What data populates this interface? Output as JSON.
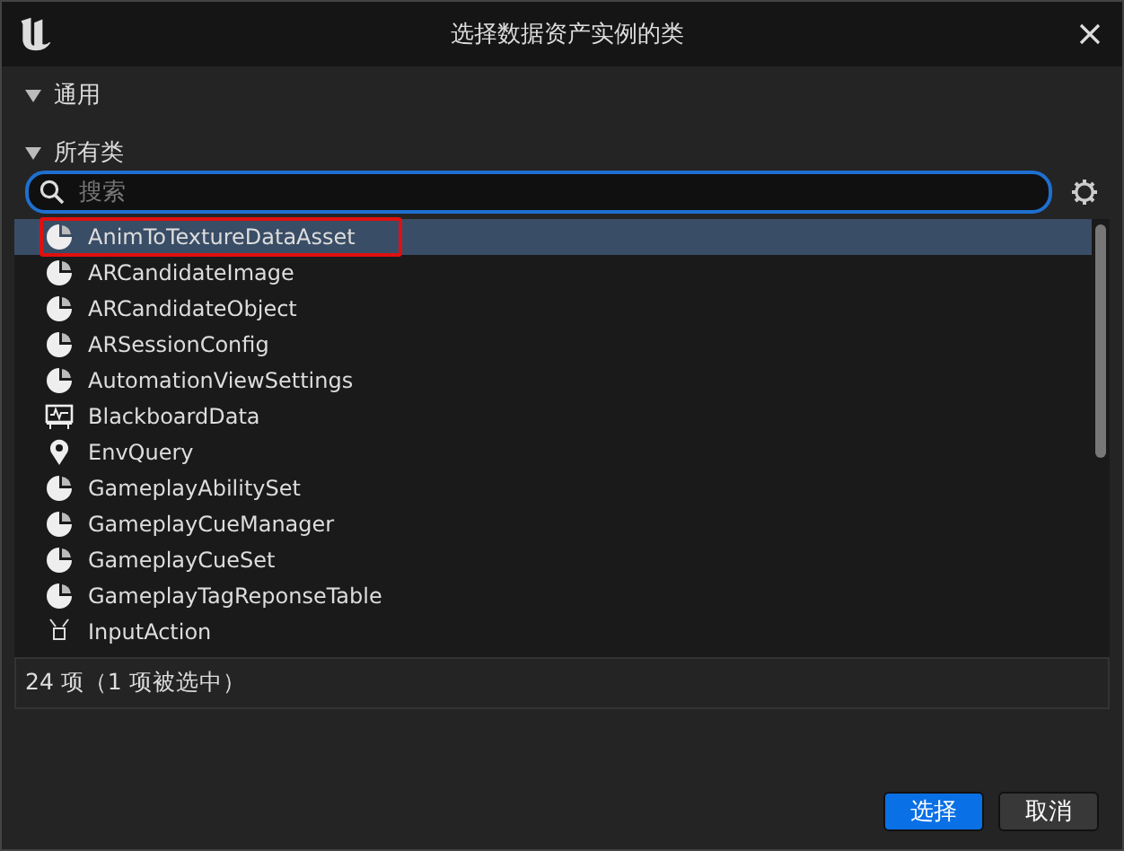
{
  "window": {
    "title": "选择数据资产实例的类"
  },
  "sections": [
    {
      "label": "通用",
      "expanded": true
    },
    {
      "label": "所有类",
      "expanded": true
    }
  ],
  "search": {
    "placeholder": "搜索"
  },
  "items": [
    {
      "label": "AnimToTextureDataAsset",
      "kind": "asset",
      "selected": true,
      "highlighted": true
    },
    {
      "label": "ARCandidateImage",
      "kind": "asset",
      "selected": false,
      "highlighted": false
    },
    {
      "label": "ARCandidateObject",
      "kind": "asset",
      "selected": false,
      "highlighted": false
    },
    {
      "label": "ARSessionConfig",
      "kind": "asset",
      "selected": false,
      "highlighted": false
    },
    {
      "label": "AutomationViewSettings",
      "kind": "asset",
      "selected": false,
      "highlighted": false
    },
    {
      "label": "BlackboardData",
      "kind": "blackboard",
      "selected": false,
      "highlighted": false
    },
    {
      "label": "EnvQuery",
      "kind": "query",
      "selected": false,
      "highlighted": false
    },
    {
      "label": "GameplayAbilitySet",
      "kind": "asset",
      "selected": false,
      "highlighted": false
    },
    {
      "label": "GameplayCueManager",
      "kind": "asset",
      "selected": false,
      "highlighted": false
    },
    {
      "label": "GameplayCueSet",
      "kind": "asset",
      "selected": false,
      "highlighted": false
    },
    {
      "label": "GameplayTagReponseTable",
      "kind": "asset",
      "selected": false,
      "highlighted": false
    },
    {
      "label": "InputAction",
      "kind": "input",
      "selected": false,
      "highlighted": false
    }
  ],
  "status": "24 项（1 项被选中）",
  "buttons": [
    {
      "label": "选择",
      "kind": "primary"
    },
    {
      "label": "取消",
      "kind": "secondary"
    }
  ]
}
